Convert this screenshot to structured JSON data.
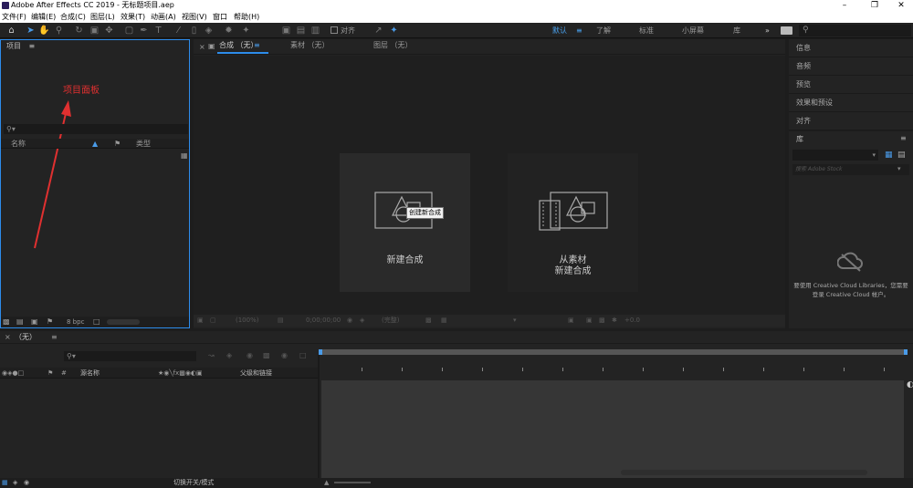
{
  "titlebar": {
    "title": "Adobe After Effects CC 2019 - 无标题项目.aep"
  },
  "menu": [
    "文件(F)",
    "编辑(E)",
    "合成(C)",
    "图层(L)",
    "效果(T)",
    "动画(A)",
    "视图(V)",
    "窗口",
    "帮助(H)"
  ],
  "toolbar": {
    "snap_label": "对齐"
  },
  "workspaces": [
    "默认",
    "了解",
    "标准",
    "小屏幕",
    "库"
  ],
  "project": {
    "title": "项目",
    "annotation": "项目面板",
    "col_name": "名称",
    "col_type": "类型",
    "bpc": "8 bpc"
  },
  "viewer": {
    "tabs": [
      "合成 （无）",
      "素材 （无）",
      "图层 （无）"
    ],
    "card1_label": "新建合成",
    "card2_line1": "从素材",
    "card2_line2": "新建合成",
    "tooltip": "创建新合成",
    "zoom": "(100%)",
    "timecode": "0;00;00;00",
    "view": "(完整)",
    "exposure": "+0.0"
  },
  "right": {
    "items": [
      "信息",
      "音频",
      "预览",
      "效果和预设",
      "对齐"
    ],
    "lib_title": "库",
    "lib_search_placeholder": "搜索 Adobe Stock",
    "lib_msg_line1": "要使用 Creative Cloud Libraries，您需要",
    "lib_msg_line2": "登录 Creative Cloud 帐户。"
  },
  "timeline": {
    "tab": "（无）",
    "col_source": "源名称",
    "col_parent": "父级和链接",
    "toggle": "切换开关/模式"
  },
  "colors": {
    "accent": "#2d8ceb",
    "annotation": "#e03030"
  }
}
